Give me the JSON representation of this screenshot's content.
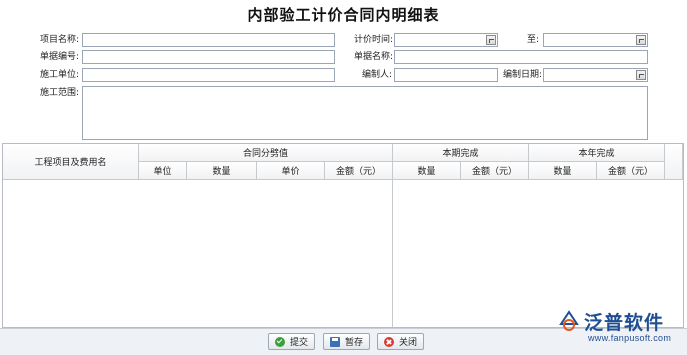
{
  "title": "内部验工计价合同内明细表",
  "form": {
    "project_name_label": "项目名称:",
    "pricing_time_label": "计价时间:",
    "to_label": "至:",
    "doc_no_label": "单据编号:",
    "doc_name_label": "单据名称:",
    "construction_unit_label": "施工单位:",
    "compiler_label": "编制人:",
    "compile_date_label": "编制日期:",
    "scope_label": "施工范围:",
    "project_name_value": "",
    "pricing_time_from": "",
    "pricing_time_to": "",
    "doc_no_value": "",
    "doc_name_value": "",
    "construction_unit_value": "",
    "compiler_value": "",
    "compile_date_value": "",
    "scope_value": ""
  },
  "grid": {
    "col_item": "工程项目及费用名",
    "group_contract": "合同分劈值",
    "group_period": "本期完成",
    "group_year": "本年完成",
    "sub_unit": "单位",
    "sub_qty": "数量",
    "sub_price": "单价",
    "sub_amount": "金额（元）",
    "period_qty": "数量",
    "period_amount": "金额（元）",
    "year_qty": "数量",
    "year_amount": "金额（元）"
  },
  "buttons": {
    "submit": "提交",
    "save": "暂存",
    "close": "关闭"
  },
  "logo": {
    "brand": "泛普软件",
    "url": "www.fanpusoft.com"
  },
  "colors": {
    "brand": "#1f4f92",
    "accent": "#e8561f"
  }
}
